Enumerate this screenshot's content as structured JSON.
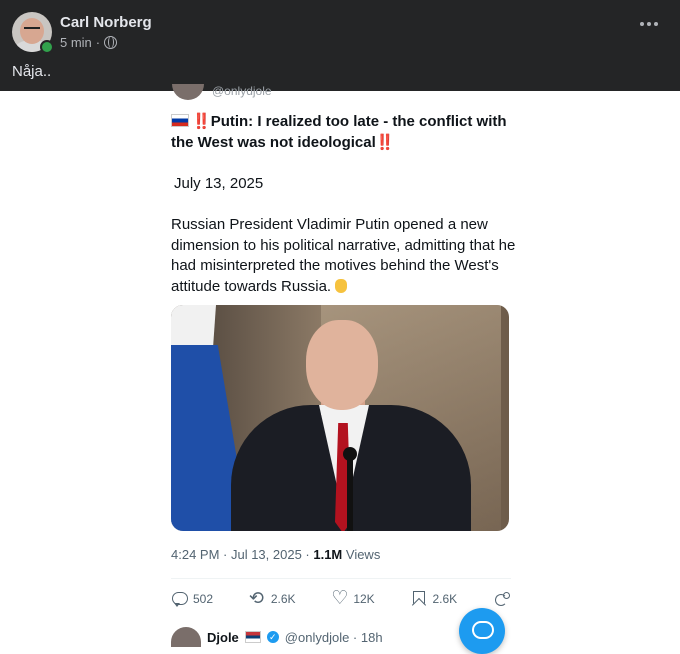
{
  "post": {
    "author": "Carl Norberg",
    "time": "5 min",
    "separator": "·",
    "text": "Nåja.."
  },
  "tweet": {
    "top_handle": "@onlydjole",
    "headline": "Putin: I realized too late - the conflict with the West was not ideological",
    "bang": "‼️",
    "date_line": "July 13, 2025",
    "body": "Russian President Vladimir Putin opened a new dimension to his political narrative, admitting that he had misinterpreted the motives behind the West's attitude towards Russia.",
    "timestamp": "4:24 PM · Jul 13, 2025 · ",
    "views_count": "1.1M",
    "views_label": " Views",
    "actions": {
      "replies": "502",
      "retweets": "2.6K",
      "likes": "12K",
      "bookmarks": "2.6K"
    }
  },
  "reply": {
    "name": "Djole",
    "handle": "@onlydjole · 18h"
  },
  "icons": [
    "globe-icon",
    "more-icon",
    "reply-icon",
    "retweet-icon",
    "like-icon",
    "bookmark-icon",
    "share-icon",
    "verified-icon",
    "chat-icon"
  ],
  "colors": {
    "header_bg": "#242526",
    "accent": "#1d9bf0",
    "alert": "#e0245e"
  }
}
